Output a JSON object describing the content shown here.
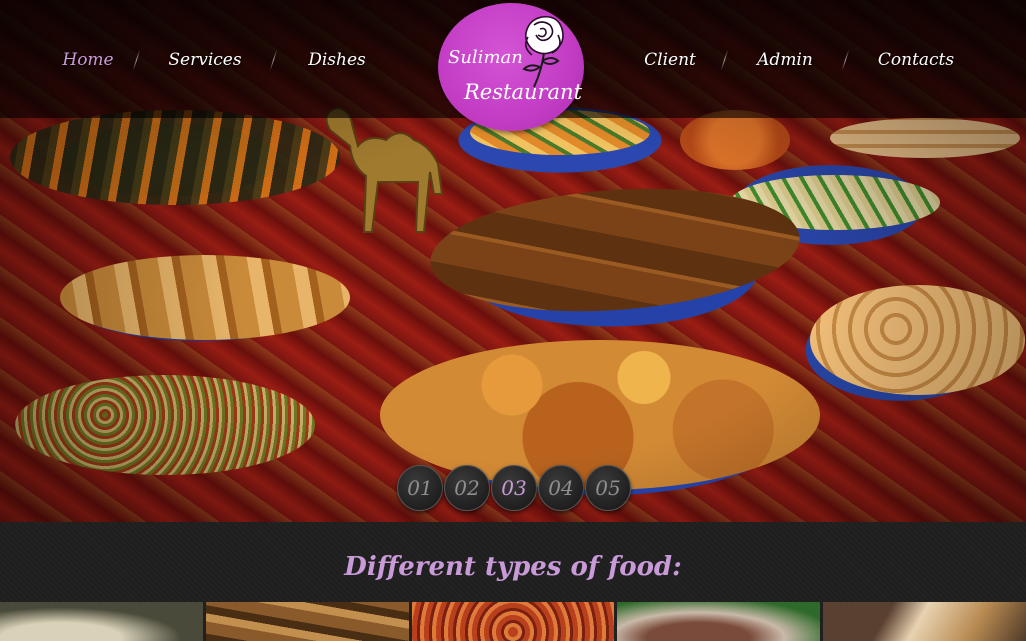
{
  "nav": {
    "items": [
      {
        "label": "Home",
        "active": true
      },
      {
        "label": "Services",
        "active": false
      },
      {
        "label": "Dishes",
        "active": false
      },
      {
        "label": "Client",
        "active": false
      },
      {
        "label": "Admin",
        "active": false
      },
      {
        "label": "Contacts",
        "active": false
      }
    ]
  },
  "logo": {
    "line1": "Suliman",
    "line2": "Restaurant",
    "icon": "rose-icon",
    "color": "#c23cc4"
  },
  "slider": {
    "pages": [
      "01",
      "02",
      "03",
      "04",
      "05"
    ],
    "active_index": 2
  },
  "section": {
    "title": "Different types of food:",
    "thumbnail_count": 5
  },
  "colors": {
    "accent": "#c99ad8",
    "logo_bg": "#c23cc4",
    "page_bg": "#1f1f1f"
  }
}
